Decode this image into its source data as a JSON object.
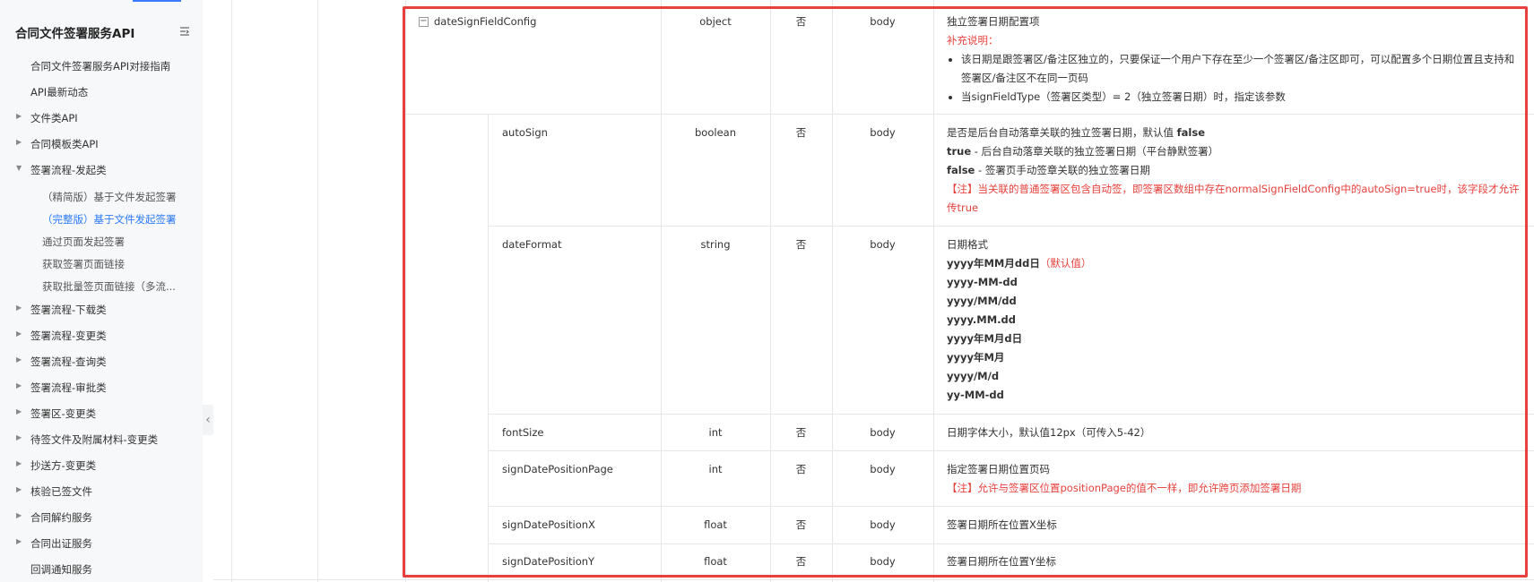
{
  "sidebar": {
    "title": "合同文件签署服务API",
    "items": [
      {
        "label": "合同文件签署服务API对接指南"
      },
      {
        "label": "API最新动态"
      },
      {
        "label": "文件类API"
      },
      {
        "label": "合同模板类API"
      },
      {
        "label": "签署流程-发起类"
      },
      {
        "label": "（精简版）基于文件发起签署"
      },
      {
        "label": "（完整版）基于文件发起签署"
      },
      {
        "label": "通过页面发起签署"
      },
      {
        "label": "获取签署页面链接"
      },
      {
        "label": "获取批量签页面链接（多流..."
      },
      {
        "label": "签署流程-下载类"
      },
      {
        "label": "签署流程-变更类"
      },
      {
        "label": "签署流程-查询类"
      },
      {
        "label": "签署流程-审批类"
      },
      {
        "label": "签署区-变更类"
      },
      {
        "label": "待签文件及附属材料-变更类"
      },
      {
        "label": "抄送方-变更类"
      },
      {
        "label": "核验已签文件"
      },
      {
        "label": "合同解约服务"
      },
      {
        "label": "合同出证服务"
      },
      {
        "label": "回调通知服务"
      }
    ]
  },
  "table": {
    "rows": [
      {
        "name": "dateSignFieldConfig",
        "type": "object",
        "required": "否",
        "location": "body",
        "desc": {
          "line1": "独立签署日期配置项",
          "note_label": "补充说明：",
          "bullet1": "该日期是跟签署区/备注区独立的，只要保证一个用户下存在至少一个签署区/备注区即可，可以配置多个日期位置且支持和签署区/备注区不在同一页码",
          "bullet2": "当signFieldType（签署区类型）= 2（独立签署日期）时，指定该参数"
        }
      },
      {
        "name": "autoSign",
        "type": "boolean",
        "required": "否",
        "location": "body",
        "desc": {
          "line1_prefix": "是否是后台自动落章关联的独立签署日期，默认值 ",
          "line1_bold": "false",
          "line2_bold": "true",
          "line2_rest": " - 后台自动落章关联的独立签署日期（平台静默签署）",
          "line3_bold": "false",
          "line3_rest": " - 签署页手动签章关联的独立签署日期",
          "warn": "【注】当关联的普通签署区包含自动签，即签署区数组中存在normalSignFieldConfig中的autoSign=true时，该字段才允许传true"
        }
      },
      {
        "name": "dateFormat",
        "type": "string",
        "required": "否",
        "location": "body",
        "desc": {
          "line1": "日期格式",
          "formats": [
            "yyyy年MM月dd日",
            "yyyy-MM-dd",
            "yyyy/MM/dd",
            "yyyy.MM.dd",
            "yyyy年M月d日",
            "yyyy年M月",
            "yyyy/M/d",
            "yy-MM-dd"
          ],
          "default_tag": "（默认值）"
        }
      },
      {
        "name": "fontSize",
        "type": "int",
        "required": "否",
        "location": "body",
        "desc": {
          "line1": "日期字体大小，默认值12px（可传入5-42）"
        }
      },
      {
        "name": "signDatePositionPage",
        "type": "int",
        "required": "否",
        "location": "body",
        "desc": {
          "line1": "指定签署日期位置页码",
          "warn": "【注】允许与签署区位置positionPage的值不一样，即允许跨页添加签署日期"
        }
      },
      {
        "name": "signDatePositionX",
        "type": "float",
        "required": "否",
        "location": "body",
        "desc": {
          "line1": "签署日期所在位置X坐标"
        }
      },
      {
        "name": "signDatePositionY",
        "type": "float",
        "required": "否",
        "location": "body",
        "desc": {
          "line1": "签署日期所在位置Y坐标"
        }
      }
    ]
  },
  "colors": {
    "accent": "#2b79ff",
    "highlight": "#e8403c",
    "note_red": "#e8403c"
  }
}
